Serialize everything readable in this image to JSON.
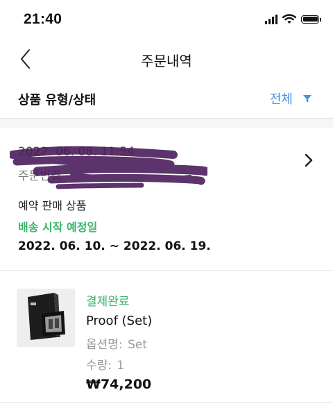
{
  "status_bar": {
    "time": "21:40"
  },
  "nav": {
    "title": "주문내역"
  },
  "filter": {
    "label": "상품 유형/상태",
    "value": "전체"
  },
  "order": {
    "date": "2022. 06. 08. 11:54",
    "number": "주문번호",
    "sale_type": "예약 판매 상품",
    "ship_label": "배송 시작 예정일",
    "ship_dates": "2022. 06. 10. ~ 2022. 06. 19."
  },
  "product": {
    "status": "결제완료",
    "name": "Proof (Set)",
    "option_key": "옵션명:",
    "option_value": "Set",
    "qty_key": "수량:",
    "qty_value": "1",
    "price": "₩74,200"
  },
  "colors": {
    "accent_blue": "#4a90d9",
    "status_green": "#3ab56b",
    "redaction_purple": "#4b1f5c"
  }
}
